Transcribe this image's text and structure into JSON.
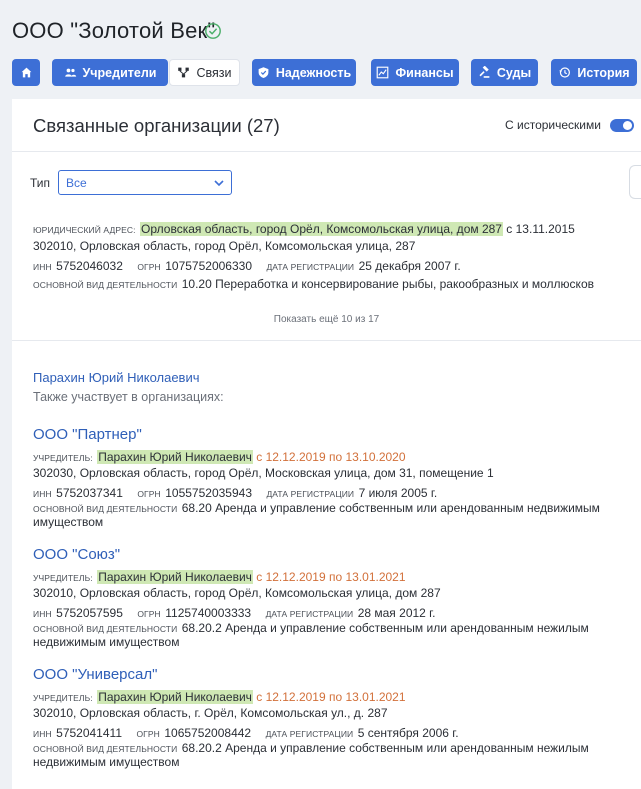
{
  "header": {
    "company_title": "ООО \"Золотой Век\"",
    "nav": [
      {
        "label": "",
        "icon": "home-icon"
      },
      {
        "label": "Учредители",
        "icon": "people-icon"
      },
      {
        "label": "Связи",
        "icon": "network-icon"
      },
      {
        "label": "Надежность",
        "icon": "shield-icon"
      },
      {
        "label": "Финансы",
        "icon": "chart-icon"
      },
      {
        "label": "Суды",
        "icon": "gavel-icon"
      },
      {
        "label": "История",
        "icon": "history-icon"
      }
    ]
  },
  "panel": {
    "title": "Связанные организации (27)",
    "historical_label": "С историческими",
    "type_label": "Тип",
    "type_value": "Все",
    "first_entry": {
      "address_label": "Юридический адрес:",
      "address": "Орловская область, город Орёл, Комсомольская улица, дом 287",
      "address_since": " с 13.11.2015",
      "postal_address": "302010, Орловская область, город Орёл, Комсомольская улица, 287",
      "inn_label": "ИНН",
      "inn": "5752046032",
      "ogrn_label": "ОГРН",
      "ogrn": "1075752006330",
      "reg_label": "Дата регистрации",
      "reg_date": "25 декабря 2007 г.",
      "activity_label": "Основной вид деятельности",
      "activity": "10.20 Переработка и консервирование рыбы, ракообразных и моллюсков"
    },
    "show_more": "Показать ещё 10 из 17",
    "person": "Парахин Юрий Николаевич",
    "also_participates": "Также участвует в организациях:",
    "orgs": [
      {
        "name": "ООО \"Партнер\"",
        "role_label": "Учредитель:",
        "person": "Парахин Юрий Николаевич",
        "period": " с 12.12.2019 по 13.10.2020",
        "address": "302030, Орловская область, город Орёл, Московская улица, дом 31, помещение 1",
        "inn_label": "ИНН",
        "inn": "5752037341",
        "ogrn_label": "ОГРН",
        "ogrn": "1055752035943",
        "reg_label": "Дата регистрации",
        "reg_date": "7 июля 2005 г.",
        "activity_label": "Основной вид деятельности",
        "activity": "68.20 Аренда и управление собственным или арендованным недвижимым имуществом"
      },
      {
        "name": "ООО \"Союз\"",
        "role_label": "Учредитель:",
        "person": "Парахин Юрий Николаевич",
        "period": " с 12.12.2019 по 13.01.2021",
        "address": "302010, Орловская область, город Орёл, Комсомольская улица, дом 287",
        "inn_label": "ИНН",
        "inn": "5752057595",
        "ogrn_label": "ОГРН",
        "ogrn": "1125740003333",
        "reg_label": "Дата регистрации",
        "reg_date": "28 мая 2012 г.",
        "activity_label": "Основной вид деятельности",
        "activity": "68.20.2 Аренда и управление собственным или арендованным нежилым недвижимым имуществом"
      },
      {
        "name": "ООО \"Универсал\"",
        "role_label": "Учредитель:",
        "person": "Парахин Юрий Николаевич",
        "period": " с 12.12.2019 по 13.01.2021",
        "address": "302010, Орловская область, г. Орёл, Комсомольская ул., д. 287",
        "inn_label": "ИНН",
        "inn": "5752041411",
        "ogrn_label": "ОГРН",
        "ogrn": "1065752008442",
        "reg_label": "Дата регистрации",
        "reg_date": "5 сентября 2006 г.",
        "activity_label": "Основной вид деятельности",
        "activity": "68.20.2 Аренда и управление собственным или арендованным нежилым недвижимым имуществом"
      }
    ]
  },
  "colors": {
    "accent": "#3d6fd6",
    "highlight": "#cfe8b4",
    "date": "#d2703a",
    "link": "#2f5fb8"
  }
}
